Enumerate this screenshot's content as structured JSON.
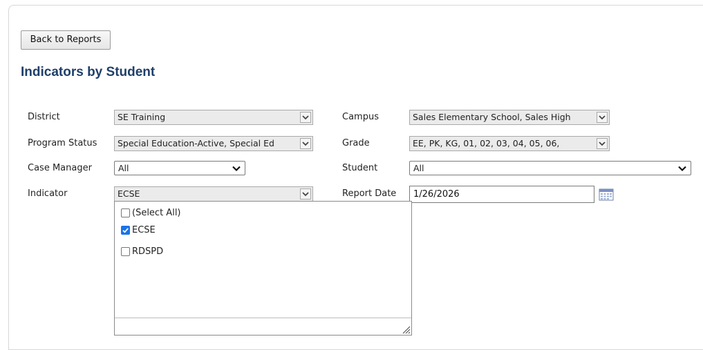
{
  "toolbar": {
    "back_label": "Back to Reports"
  },
  "page": {
    "title": "Indicators by Student"
  },
  "filters": {
    "district": {
      "label": "District",
      "value": "SE Training"
    },
    "campus": {
      "label": "Campus",
      "value": "Sales Elementary School, Sales High"
    },
    "program_status": {
      "label": "Program Status",
      "value": "Special Education-Active, Special Ed"
    },
    "grade": {
      "label": "Grade",
      "value": "EE, PK, KG, 01, 02, 03, 04, 05, 06,"
    },
    "case_manager": {
      "label": "Case Manager",
      "value": "All"
    },
    "student": {
      "label": "Student",
      "value": "All"
    },
    "indicator": {
      "label": "Indicator",
      "value": "ECSE",
      "options": [
        {
          "label": "(Select All)",
          "checked": false
        },
        {
          "label": "ECSE",
          "checked": true
        },
        {
          "label": "RDSPD",
          "checked": false
        }
      ]
    },
    "report_date": {
      "label": "Report Date",
      "value": "1/26/2026"
    }
  },
  "icons": {
    "calendar": "calendar-icon",
    "dropdown": "chevron-down-icon",
    "resize": "resize-grip-icon"
  },
  "colors": {
    "title": "#1f3f6a",
    "checkbox_checked": "#1a73e8"
  }
}
